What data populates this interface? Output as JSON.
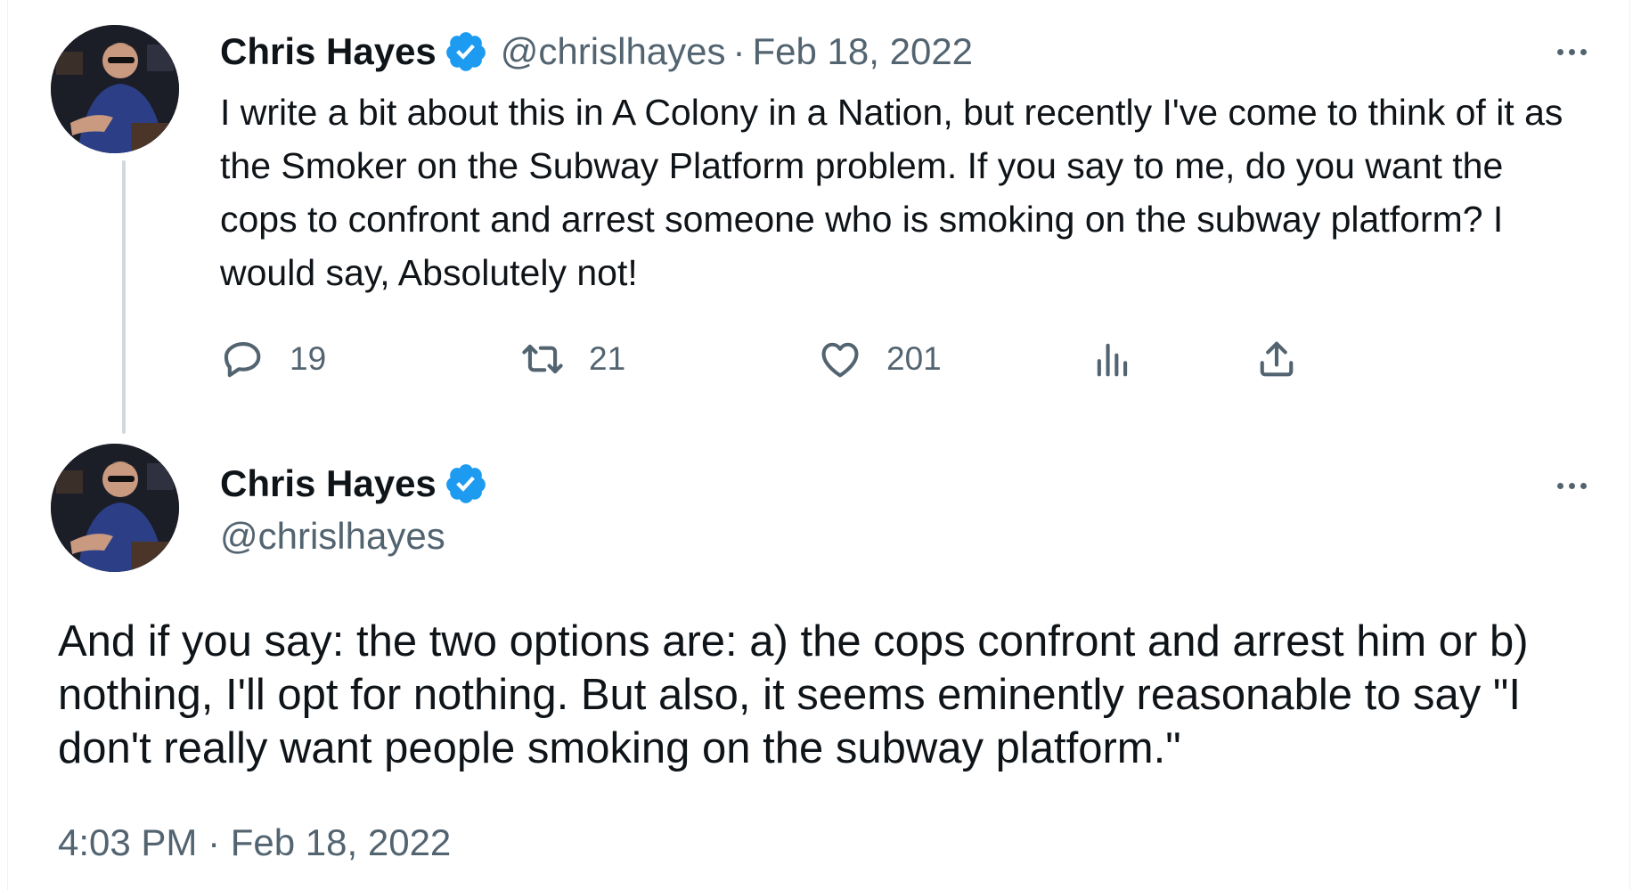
{
  "tweet1": {
    "author_name": "Chris Hayes",
    "handle": "@chrislhayes",
    "separator": "·",
    "date": "Feb 18, 2022",
    "text": "I write a bit about this in A Colony in a Nation, but recently I've come to think of it as the Smoker on the Subway Platform problem. If you say to me, do you want the cops to confront and arrest someone who is smoking on the subway platform? I would say, Absolutely not!",
    "replies": "19",
    "retweets": "21",
    "likes": "201"
  },
  "tweet2": {
    "author_name": "Chris Hayes",
    "handle": "@chrislhayes",
    "text": "And if you say: the two options are: a) the cops confront and arrest him or b) nothing, I'll opt for nothing. But also, it seems eminently reasonable to say \"I don't really want people smoking on the subway platform.\"",
    "time": "4:03 PM",
    "separator": "·",
    "date": "Feb 18, 2022"
  },
  "colors": {
    "verified_badge": "#1d9bf0",
    "secondary_text": "#536471",
    "thread_line": "#cfd9de"
  },
  "icons": [
    "verified-badge-icon",
    "reply-icon",
    "retweet-icon",
    "like-icon",
    "views-icon",
    "share-icon",
    "more-icon"
  ]
}
